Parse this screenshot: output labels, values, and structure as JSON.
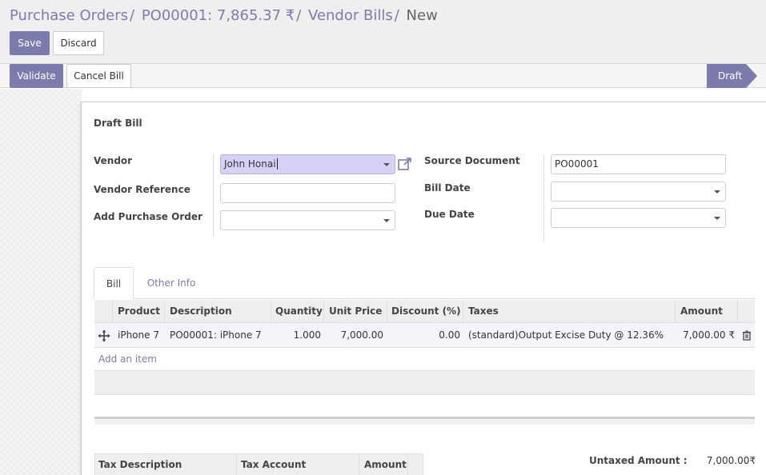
{
  "breadcrumb": {
    "items": [
      "Purchase Orders",
      "PO00001: 7,865.37 ₹",
      "Vendor Bills"
    ],
    "separator": "/",
    "current": "New"
  },
  "actions": {
    "save_label": "Save",
    "discard_label": "Discard"
  },
  "statusbar": {
    "validate_label": "Validate",
    "cancel_label": "Cancel Bill",
    "status": "Draft"
  },
  "form": {
    "title": "Draft Bill",
    "vendor_label": "Vendor",
    "vendor_value": "John Honai",
    "vendor_ref_label": "Vendor Reference",
    "vendor_ref_value": "",
    "add_po_label": "Add Purchase Order",
    "add_po_value": "",
    "source_doc_label": "Source Document",
    "source_doc_value": "PO00001",
    "bill_date_label": "Bill Date",
    "bill_date_value": "",
    "due_date_label": "Due Date",
    "due_date_value": ""
  },
  "tabs": [
    {
      "label": "Bill",
      "active": true
    },
    {
      "label": "Other Info",
      "active": false
    }
  ],
  "lines": {
    "headers": [
      "Product",
      "Description",
      "Quantity",
      "Unit Price",
      "Discount (%)",
      "Taxes",
      "Amount"
    ],
    "rows": [
      {
        "product": "iPhone 7",
        "description": "PO00001: iPhone 7",
        "quantity": "1.000",
        "unit_price": "7,000.00",
        "discount": "0.00",
        "taxes": "(standard)Output Excise Duty @ 12.36%",
        "amount": "7,000.00 ₹"
      }
    ],
    "add_item": "Add an item"
  },
  "tax_table": {
    "headers": [
      "Tax Description",
      "Tax Account",
      "Amount"
    ]
  },
  "totals": {
    "untaxed_label": "Untaxed Amount :",
    "untaxed_value": "7,000.00₹"
  },
  "colors": {
    "accent": "#7c7bad",
    "highlight": "#d6d2f6"
  }
}
